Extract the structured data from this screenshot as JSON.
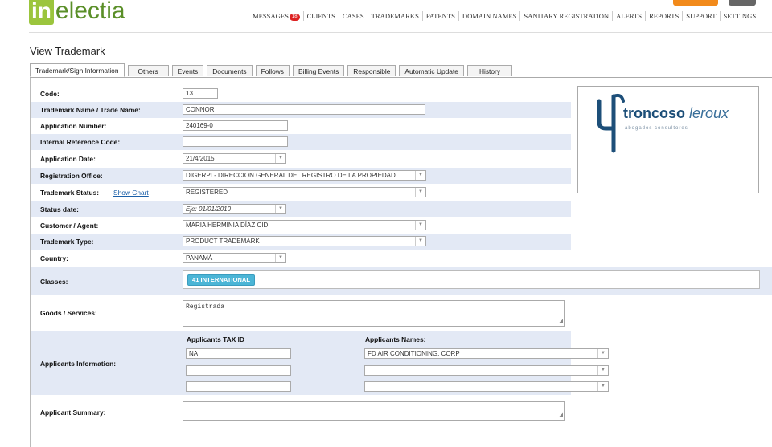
{
  "brand": {
    "logo_box": "in",
    "logo_rest": "electia"
  },
  "nav": {
    "messages": "MESSAGES",
    "messages_count": "18",
    "items": [
      "CLIENTS",
      "CASES",
      "TRADEMARKS",
      "PATENTS",
      "DOMAIN NAMES",
      "SANITARY REGISTRATION",
      "ALERTS",
      "REPORTS",
      "SUPPORT",
      "SETTINGS"
    ]
  },
  "page_title": "View Trademark",
  "tabs": [
    "Trademark/Sign Information",
    "Others",
    "Events",
    "Documents",
    "Follows",
    "Billing Events",
    "Responsible",
    "Automatic Update",
    "History"
  ],
  "active_tab": "Trademark/Sign Information",
  "form": {
    "code": {
      "label": "Code:",
      "value": "13"
    },
    "name": {
      "label": "Trademark Name / Trade Name:",
      "value": "CONNOR"
    },
    "application_number": {
      "label": "Application Number:",
      "value": "240169-0"
    },
    "internal_reference": {
      "label": "Internal Reference Code:",
      "value": ""
    },
    "application_date": {
      "label": "Application Date:",
      "value": "21/4/2015"
    },
    "registration_office": {
      "label": "Registration Office:",
      "value": "DIGERPI - DIRECCION GENERAL DEL REGISTRO DE LA PROPIEDAD"
    },
    "status": {
      "label": "Trademark Status:",
      "link": "Show Chart",
      "value": "REGISTERED"
    },
    "status_date": {
      "label": "Status date:",
      "value": "Eje: 01/01/2010"
    },
    "customer": {
      "label": "Customer / Agent:",
      "value": "MARIA HERMINIA DÍAZ CID"
    },
    "type": {
      "label": "Trademark Type:",
      "value": "PRODUCT TRADEMARK"
    },
    "country": {
      "label": "Country:",
      "value": "PANAMÁ"
    },
    "classes": {
      "label": "Classes:",
      "chip": "41 INTERNATIONAL"
    },
    "goods": {
      "label": "Goods / Services:",
      "value": "Registrada"
    },
    "applicants": {
      "label": "Applicants Information:",
      "tax_header": "Applicants TAX ID",
      "names_header": "Applicants Names:",
      "rows": [
        {
          "tax": "NA",
          "name": "FD AIR CONDITIONING, CORP"
        },
        {
          "tax": "",
          "name": ""
        },
        {
          "tax": "",
          "name": ""
        }
      ]
    },
    "summary": {
      "label": "Applicant Summary:",
      "value": ""
    }
  },
  "law_firm_logo": {
    "name_bold": "troncoso",
    "name_light": "leroux",
    "tagline": "abogados consultores"
  },
  "colors": {
    "accent_green": "#9bc53d",
    "row_shade": "#e3e9f5",
    "chip": "#4bb5d6",
    "badge": "#dd2222",
    "link": "#1a5fa8"
  }
}
